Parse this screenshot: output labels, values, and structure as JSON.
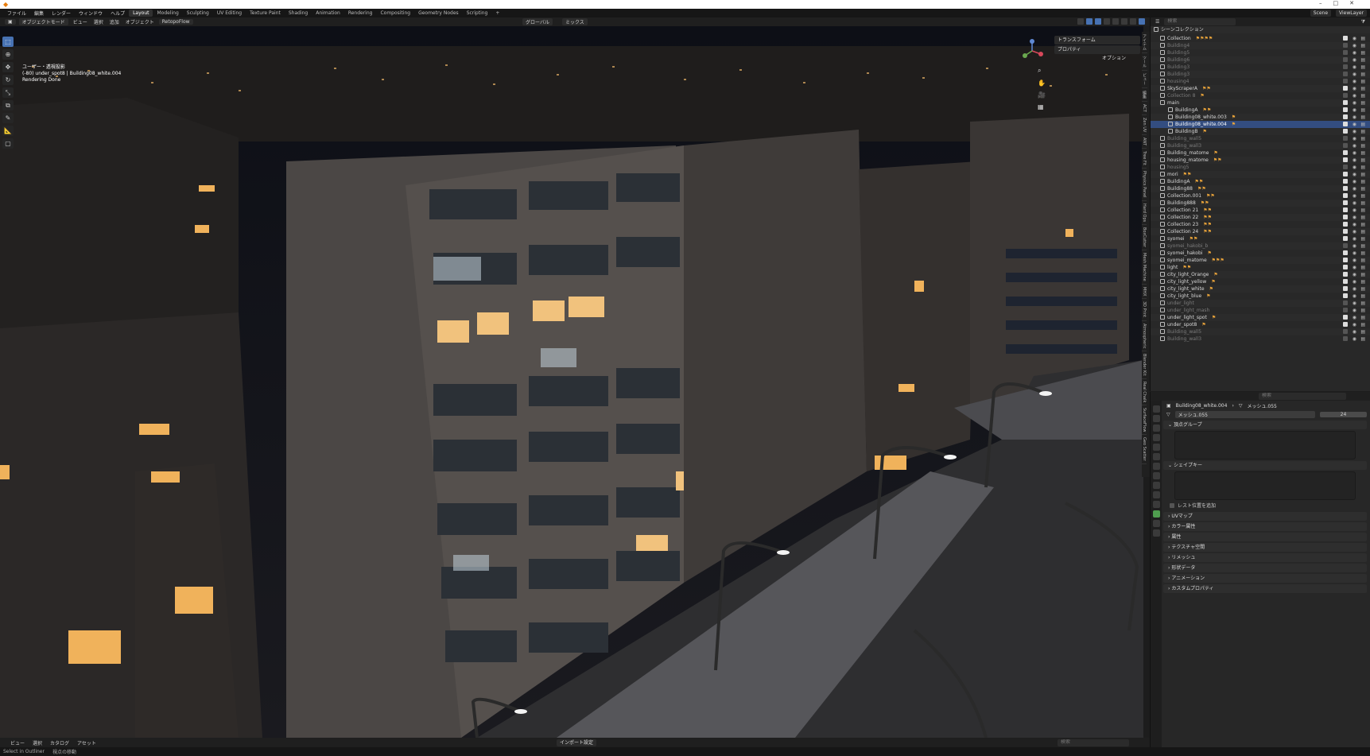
{
  "menu": {
    "items": [
      "ファイル",
      "編集",
      "レンダー",
      "ウィンドウ",
      "ヘルプ"
    ],
    "workspaces": [
      "Layout",
      "Modeling",
      "Sculpting",
      "UV Editing",
      "Texture Paint",
      "Shading",
      "Animation",
      "Rendering",
      "Compositing",
      "Geometry Nodes",
      "Scripting"
    ],
    "add_tab": "+",
    "scene": "Scene",
    "view_layer": "ViewLayer"
  },
  "header": {
    "mode": "オブジェクトモード",
    "items": [
      "ビュー",
      "選択",
      "追加",
      "オブジェクト"
    ],
    "addon": "RetopoFlow",
    "orientation": "グローバル",
    "snap": "ミックス"
  },
  "viewport": {
    "view_name": "ユーザー・透視投影",
    "object_line": "(-80) under_spot8 | Building08_white.004",
    "status": "Rendering Done",
    "options": "オプション"
  },
  "npanel": {
    "panels": [
      "トランスフォーム",
      "プロパティ"
    ],
    "tabs": [
      "アイテム",
      "ツール",
      "ビュー",
      "編集",
      "ACT",
      "Zen UV",
      "ANT",
      "Tree Fit",
      "Physics Panel",
      "Hard Ops",
      "BoxCutter",
      "Mesh Machine",
      "MHX",
      "3D Print",
      "Atmospheric",
      "Blender Kit",
      "Real Chalk",
      "SurfaceFlow",
      "Geo Scatter"
    ]
  },
  "outliner": {
    "title": "シーンコレクション",
    "search_placeholder": "検索",
    "rows": [
      {
        "name": "Collection",
        "dim": false,
        "tags": "⚑⚑⚑⚑"
      },
      {
        "name": "Building4",
        "dim": true,
        "tags": ""
      },
      {
        "name": "Building5",
        "dim": true,
        "tags": ""
      },
      {
        "name": "Building6",
        "dim": true,
        "tags": ""
      },
      {
        "name": "Building3",
        "dim": true,
        "tags": ""
      },
      {
        "name": "Building3",
        "dim": true,
        "tags": ""
      },
      {
        "name": "housing4",
        "dim": true,
        "tags": ""
      },
      {
        "name": "SkyScraperA",
        "dim": false,
        "tags": "⚑⚑"
      },
      {
        "name": "Collection 8",
        "dim": true,
        "tags": "⚑"
      },
      {
        "name": "main",
        "dim": false,
        "tags": ""
      },
      {
        "name": "BuildingA",
        "dim": false,
        "tags": "⚑⚑"
      },
      {
        "name": "Building08_white.003",
        "dim": false,
        "tags": "⚑"
      },
      {
        "name": "Building08_white.004",
        "dim": false,
        "tags": "⚑",
        "sel": true
      },
      {
        "name": "BuildingB",
        "dim": false,
        "tags": "⚑"
      },
      {
        "name": "Building_wall5",
        "dim": true,
        "tags": ""
      },
      {
        "name": "Building_wall3",
        "dim": true,
        "tags": ""
      },
      {
        "name": "Building_matome",
        "dim": false,
        "tags": "⚑"
      },
      {
        "name": "housing_matome",
        "dim": false,
        "tags": "⚑⚑"
      },
      {
        "name": "housing5",
        "dim": true,
        "tags": ""
      },
      {
        "name": "mori",
        "dim": false,
        "tags": "⚑⚑"
      },
      {
        "name": "BuildingA",
        "dim": false,
        "tags": "⚑⚑"
      },
      {
        "name": "Building88",
        "dim": false,
        "tags": "⚑⚑"
      },
      {
        "name": "Collection.001",
        "dim": false,
        "tags": "⚑⚑"
      },
      {
        "name": "Building888",
        "dim": false,
        "tags": "⚑⚑"
      },
      {
        "name": "Collection 21",
        "dim": false,
        "tags": "⚑⚑"
      },
      {
        "name": "Collection 22",
        "dim": false,
        "tags": "⚑⚑"
      },
      {
        "name": "Collection 23",
        "dim": false,
        "tags": "⚑⚑"
      },
      {
        "name": "Collection 24",
        "dim": false,
        "tags": "⚑⚑"
      },
      {
        "name": "syomei",
        "dim": false,
        "tags": "⚑⚑"
      },
      {
        "name": "syomei_hakobi_b",
        "dim": true,
        "tags": ""
      },
      {
        "name": "syomei_hakobi",
        "dim": false,
        "tags": "⚑"
      },
      {
        "name": "syomei_matome",
        "dim": false,
        "tags": "⚑⚑⚑"
      },
      {
        "name": "light",
        "dim": false,
        "tags": "⚑⚑"
      },
      {
        "name": "city_light_Orange",
        "dim": false,
        "tags": "⚑"
      },
      {
        "name": "city_light_yellow",
        "dim": false,
        "tags": "⚑"
      },
      {
        "name": "city_light_white",
        "dim": false,
        "tags": "⚑"
      },
      {
        "name": "city_light_blue",
        "dim": false,
        "tags": "⚑"
      },
      {
        "name": "under_light",
        "dim": true,
        "tags": ""
      },
      {
        "name": "under_light_mash",
        "dim": true,
        "tags": ""
      },
      {
        "name": "under_light_spot",
        "dim": false,
        "tags": "⚑"
      },
      {
        "name": "under_spot8",
        "dim": false,
        "tags": "⚑"
      },
      {
        "name": "Building_wall5",
        "dim": true,
        "tags": ""
      },
      {
        "name": "Building_wall3",
        "dim": true,
        "tags": ""
      }
    ]
  },
  "properties": {
    "breadcrumb_object": "Building08_white.004",
    "breadcrumb_mesh": "メッシュ.055",
    "mesh_name": "メッシュ.055",
    "users": "24",
    "vertex_groups": "頂点グループ",
    "shape_keys": "シェイプキー",
    "rest_position": "レスト位置を追加",
    "panels": [
      "UVマップ",
      "カラー属性",
      "属性",
      "テクスチャ空間",
      "リメッシュ",
      "形状データ",
      "アニメーション",
      "カスタムプロパティ"
    ]
  },
  "bottom": {
    "items": [
      "ビュー",
      "選択",
      "カタログ",
      "アセット"
    ],
    "import": "インポート設定",
    "search_placeholder": "検索"
  },
  "status": {
    "left": "Select in Outliner",
    "mid": "視点の移動"
  }
}
